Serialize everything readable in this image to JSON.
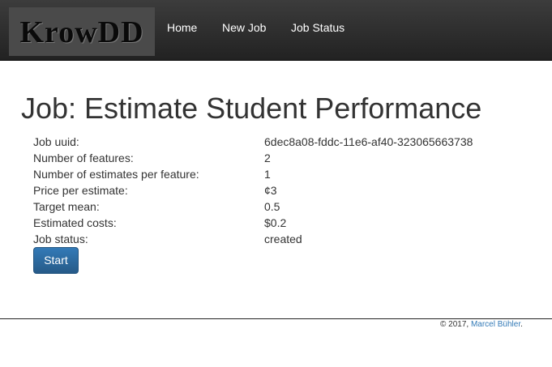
{
  "navbar": {
    "brand": "KrowDD",
    "items": [
      {
        "label": "Home"
      },
      {
        "label": "New Job"
      },
      {
        "label": "Job Status"
      }
    ]
  },
  "page": {
    "title": "Job: Estimate Student Performance"
  },
  "details": [
    {
      "label": "Job uuid:",
      "value": "6dec8a08-fddc-11e6-af40-323065663738"
    },
    {
      "label": "Number of features:",
      "value": "2"
    },
    {
      "label": "Number of estimates per feature:",
      "value": "1"
    },
    {
      "label": "Price per estimate:",
      "value": "¢3"
    },
    {
      "label": "Target mean:",
      "value": "0.5"
    },
    {
      "label": "Estimated costs:",
      "value": "$0.2"
    },
    {
      "label": "Job status:",
      "value": "created"
    }
  ],
  "actions": {
    "start_label": "Start"
  },
  "footer": {
    "copyright": "© 2017,",
    "author": "Marcel Bühler",
    "suffix": "."
  }
}
